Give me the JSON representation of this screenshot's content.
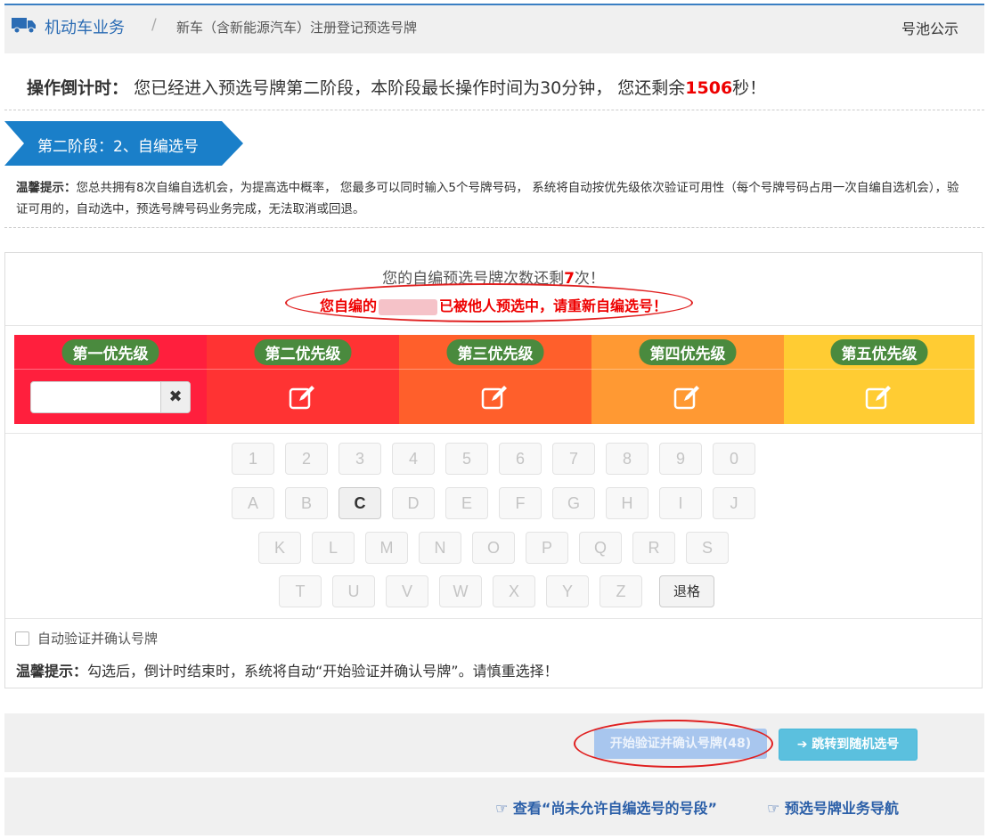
{
  "header": {
    "brand": "机动车业务",
    "separator": "/",
    "crumb": "新车（含新能源汽车）注册登记预选号牌",
    "pool": "号池公示"
  },
  "countdown": {
    "label": "操作倒计时：",
    "text1": "您已经进入预选号牌第二阶段，本阶段最长操作时间为30分钟， 您还剩余",
    "seconds": "1506",
    "text2": "秒！"
  },
  "stage": {
    "title": "第二阶段：2、自编选号"
  },
  "tip": {
    "label": "温馨提示：",
    "text": "您总共拥有8次自编自选机会，为提高选中概率， 您最多可以同时输入5个号牌号码， 系统将自动按优先级依次验证可用性（每个号牌号码占用一次自编自选机会），验证可用的，自动选中，预选号牌号码业务完成，无法取消或回退。"
  },
  "remain": {
    "before": "您的自编预选号牌次数还剩",
    "count": "7",
    "after": "次！"
  },
  "warning": {
    "before": "您自编的",
    "after": "已被他人预选中，请重新自编选号！"
  },
  "priorities": [
    {
      "label": "第一优先级",
      "color": "#ff1f3d"
    },
    {
      "label": "第二优先级",
      "color": "#ff3333"
    },
    {
      "label": "第三优先级",
      "color": "#ff5f2b"
    },
    {
      "label": "第四优先级",
      "color": "#ff9933"
    },
    {
      "label": "第五优先级",
      "color": "#ffcc33"
    }
  ],
  "clear_glyph": "✖",
  "keyboard": {
    "row1": [
      "1",
      "2",
      "3",
      "4",
      "5",
      "6",
      "7",
      "8",
      "9",
      "0"
    ],
    "row2": [
      "A",
      "B",
      "C",
      "D",
      "E",
      "F",
      "G",
      "H",
      "I",
      "J"
    ],
    "row3": [
      "K",
      "L",
      "M",
      "N",
      "O",
      "P",
      "Q",
      "R",
      "S"
    ],
    "row4": [
      "T",
      "U",
      "V",
      "W",
      "X",
      "Y",
      "Z"
    ],
    "active": "C",
    "backspace": "退格"
  },
  "auto": {
    "label": "自动验证并确认号牌",
    "checked": false
  },
  "tip2": {
    "label": "温馨提示：",
    "text": "勾选后，倒计时结束时，系统将自动“开始验证并确认号牌”。请慎重选择！"
  },
  "actions": {
    "verify": "开始验证并确认号牌(48)",
    "random": "跳转到随机选号"
  },
  "links": {
    "not_allowed": "查看“尚未允许自编选号的号段”",
    "guide": "预选号牌业务导航"
  }
}
